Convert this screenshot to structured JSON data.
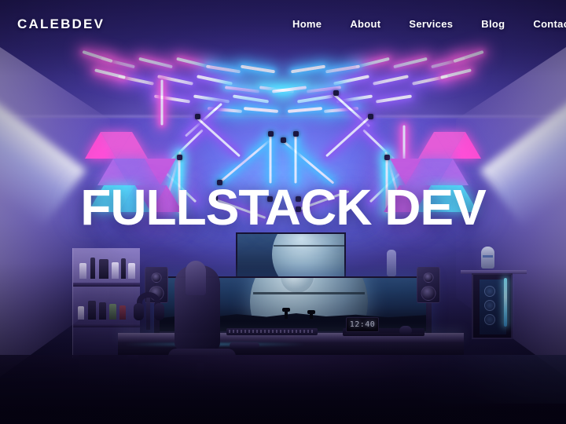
{
  "page": {
    "type": "portfolio-landing-hero",
    "background_description": "neon-lit RGB gaming room with ultrawide monitor, hexagon wall lights and triangular LED panels"
  },
  "navbar": {
    "logo": "CALEBDEV",
    "links": [
      {
        "label": "Home"
      },
      {
        "label": "About"
      },
      {
        "label": "Services"
      },
      {
        "label": "Blog"
      },
      {
        "label": "Contact"
      }
    ]
  },
  "hero": {
    "title": "FULLSTACK DEV"
  },
  "scene": {
    "clock_time": "12:40",
    "icons": {
      "logo": "wordmark-logo",
      "monitor": "ultrawide-monitor",
      "clock": "digital-clock"
    }
  },
  "colors": {
    "accent_purple": "#8a5cf0",
    "accent_blue": "#4fb8ff",
    "accent_pink": "#e45cd8",
    "accent_magenta": "#ff4fd8",
    "accent_cyan": "#56e0ff",
    "text_white": "#ffffff",
    "nav_bg": "#3b2f86",
    "room_base": "#5246b8",
    "floor_dark": "#080512"
  }
}
